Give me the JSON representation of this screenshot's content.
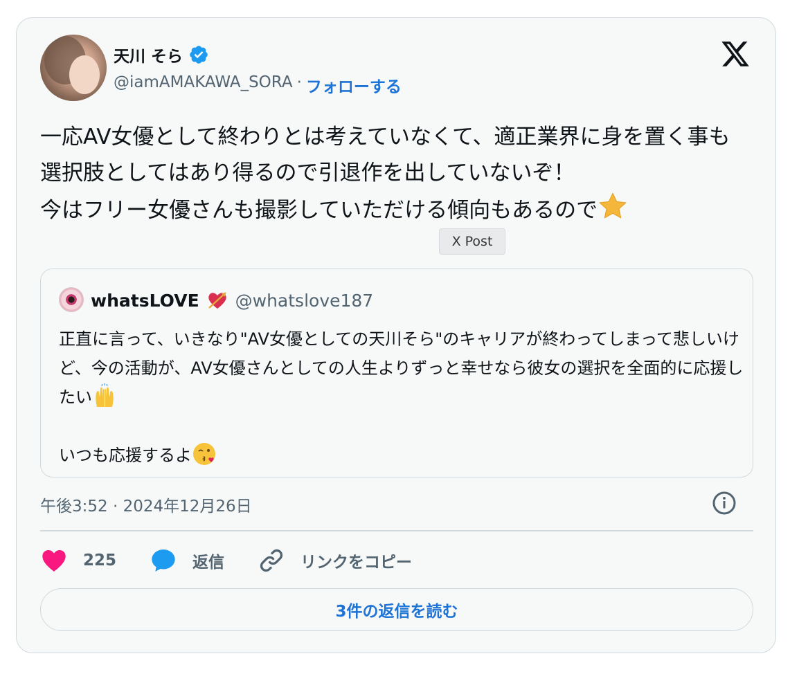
{
  "author": {
    "name": "天川 そら",
    "handle": "@iamAMAKAWA_SORA",
    "separator": "·",
    "follow_label": "フォローする"
  },
  "tweet": {
    "text": "一応AV女優として終わりとは考えていなくて、適正業界に身を置く事も選択肢としてはあり得るので引退作を出していないぞ！\n今はフリー女優さんも撮影していただける傾向もあるので",
    "emoji": "star"
  },
  "tooltip": "X Post",
  "quote": {
    "name": "whatsLOVE",
    "name_emoji": "heart-with-arrow",
    "handle": "@whatslove187",
    "text_part1": "正直に言って、いきなり\"AV女優としての天川そら\"のキャリアが終わってしまって悲しいけど、今の活動が、AV女優さんとしての人生よりずっと幸せなら彼女の選択を全面的に応援したい",
    "emoji1": "raising-hands",
    "text_part2": "\n\nいつも応援するよ",
    "emoji2": "kissing-face"
  },
  "meta": {
    "timestamp": "午後3:52 · 2024年12月26日"
  },
  "actions": {
    "like_count": "225",
    "reply_label": "返信",
    "copy_link_label": "リンクをコピー"
  },
  "replies_button": "3件の返信を読む",
  "colors": {
    "accent": "#1d73d6",
    "like": "#f91880",
    "reply": "#1d9bf0",
    "muted": "#536471",
    "border": "#cfd9de",
    "card_bg": "#f7f9f9"
  }
}
